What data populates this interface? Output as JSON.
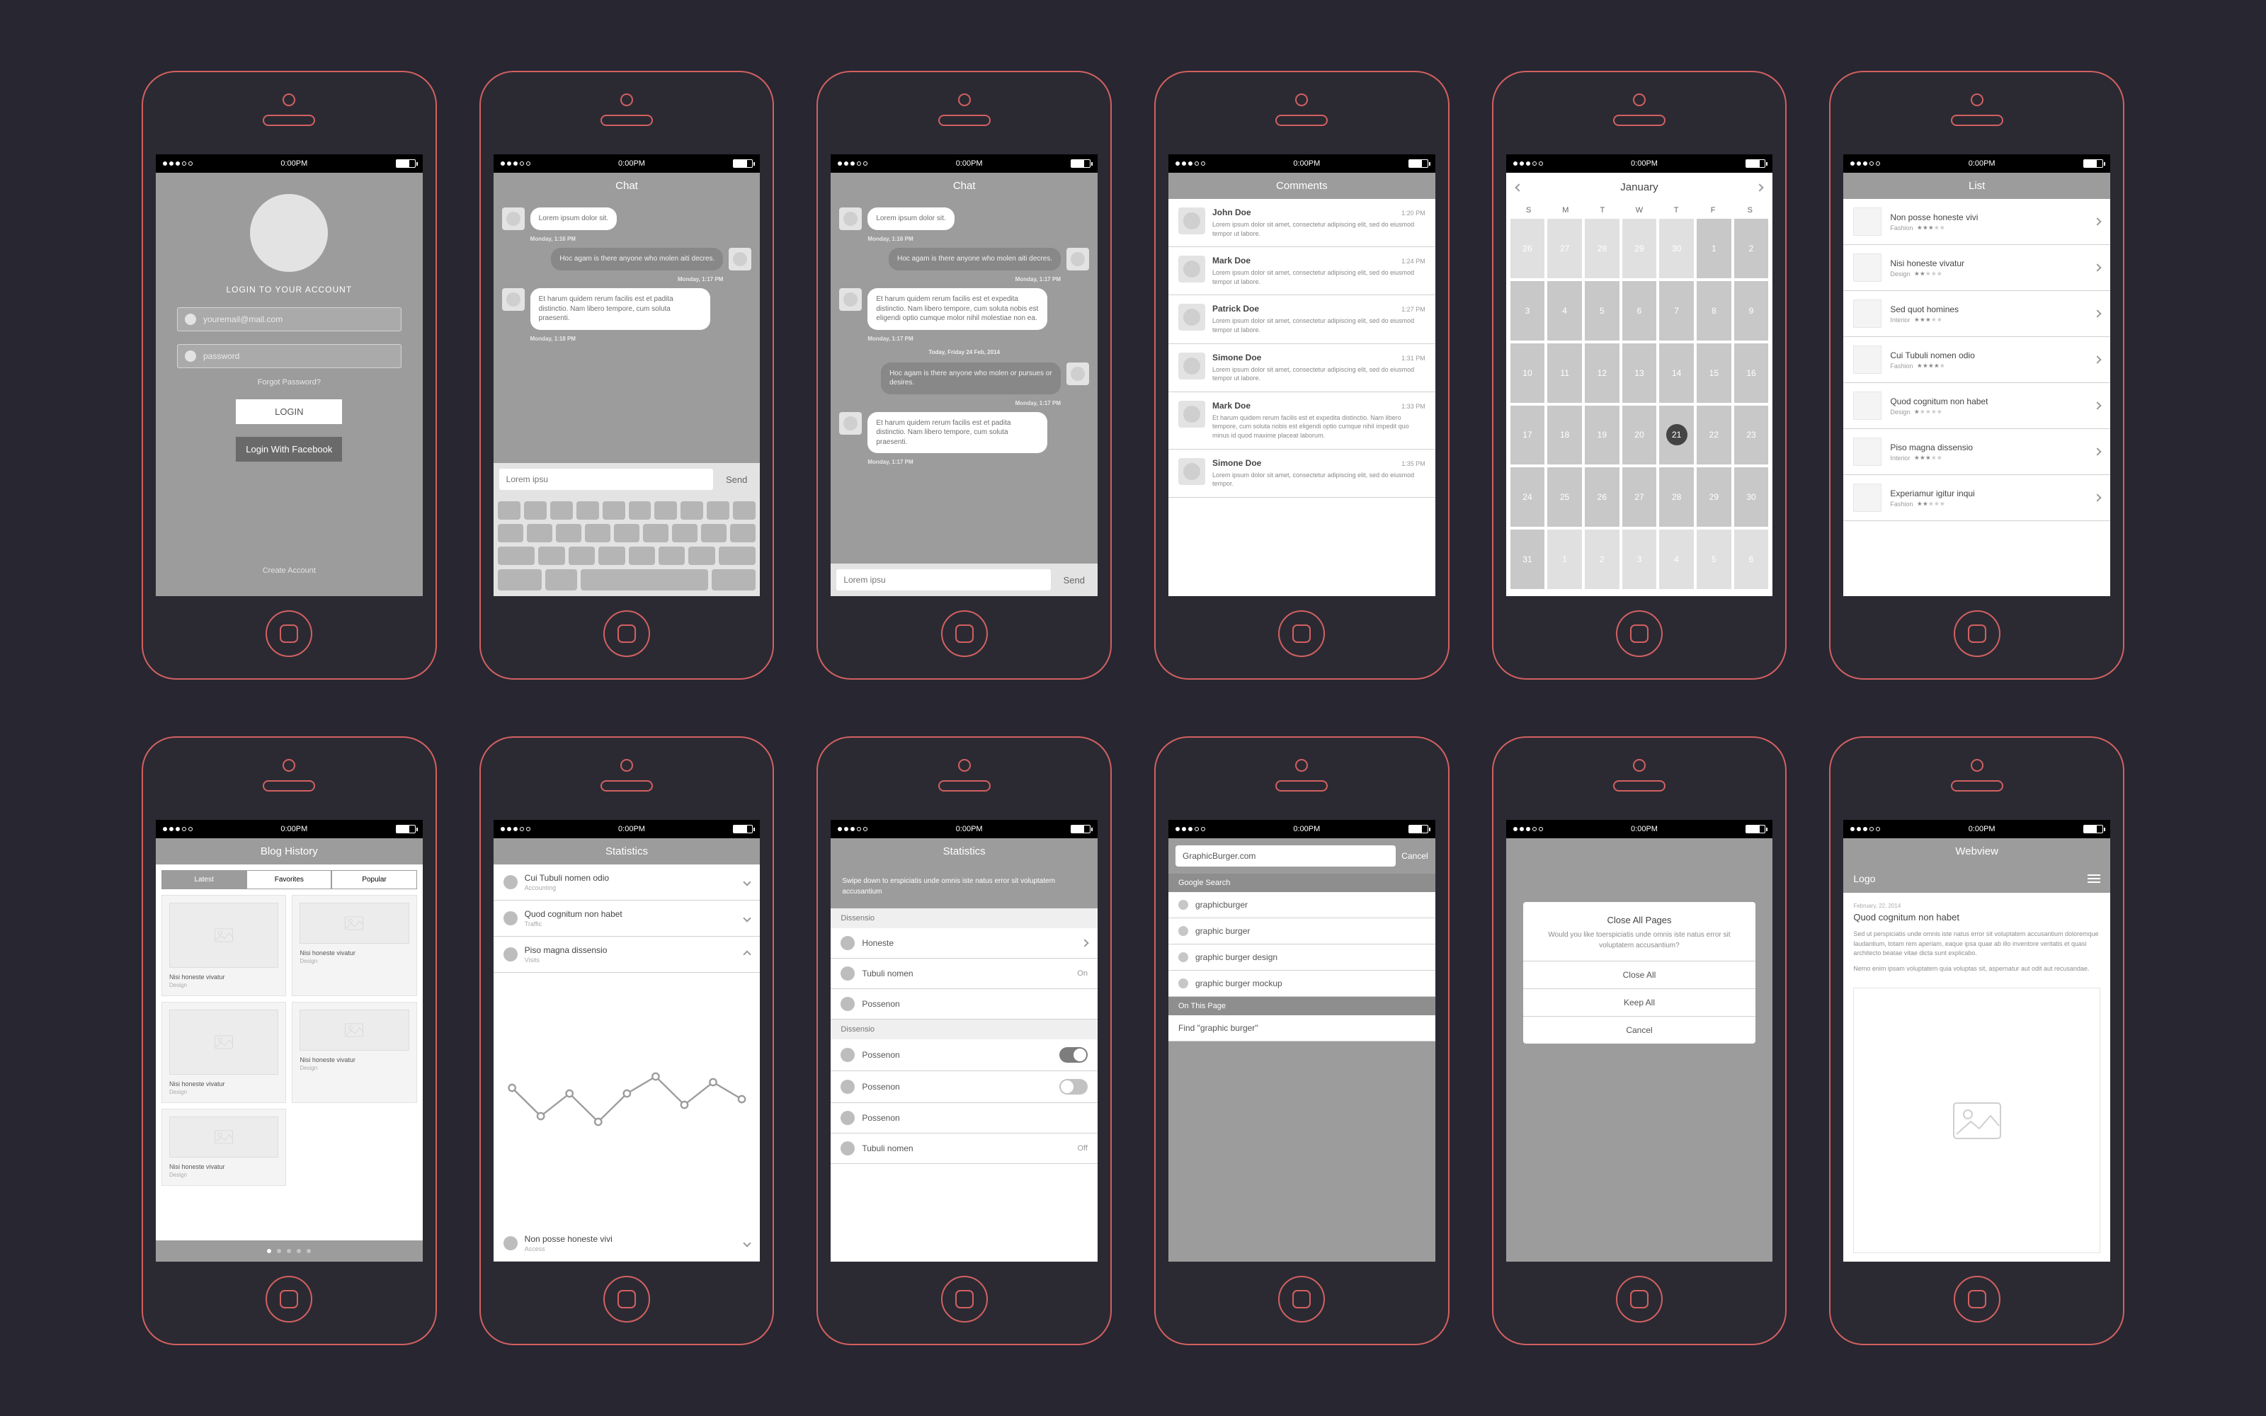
{
  "status": {
    "time": "0:00PM"
  },
  "login": {
    "heading": "LOGIN TO YOUR ACCOUNT",
    "email_placeholder": "youremail@mail.com",
    "password_placeholder": "password",
    "forgot": "Forgot Password?",
    "login_btn": "LOGIN",
    "fb_btn": "Login With Facebook",
    "create": "Create Account"
  },
  "chat": {
    "title": "Chat",
    "compose_placeholder": "Lorem ipsu",
    "send": "Send",
    "short": {
      "m1": "Lorem ipsum dolor sit.",
      "s1": "Monday, 1:16 PM",
      "m2": "Hoc agam is there anyone who molen aiti decres.",
      "s2": "Monday, 1:17 PM",
      "m3": "Et harum quidem rerum facilis est et padita distinctio. Nam libero tempore, cum soluta praesenti.",
      "s3": "Monday, 1:18 PM"
    },
    "long": {
      "m1": "Lorem ipsum dolor sit.",
      "s1": "Monday, 1:16 PM",
      "m2": "Hoc agam is there anyone who molen aiti decres.",
      "s2": "Monday, 1:17 PM",
      "m3": "Et harum quidem rerum facilis est et expedita distinctio. Nam libero tempore, cum soluta nobis est eligendi optio cumque molor nihil molestiae non ea.",
      "s3": "Monday, 1:17 PM",
      "day": "Today, Friday 24 Feb, 2014",
      "m4": "Hoc agam is there anyone who molen or pursues or desires.",
      "s4": "Monday, 1:17 PM",
      "m5": "Et harum quidem rerum facilis est et padita distinctio. Nam libero tempore, cum soluta praesenti.",
      "s5": "Monday, 1:17 PM"
    }
  },
  "comments": {
    "title": "Comments",
    "items": [
      {
        "name": "John Doe",
        "time": "1:20 PM",
        "text": "Lorem ipsum dolor sit amet, consectetur adipiscing elit, sed do eiusmod tempor ut labore."
      },
      {
        "name": "Mark Doe",
        "time": "1:24 PM",
        "text": "Lorem ipsum dolor sit amet, consectetur adipiscing elit, sed do eiusmod tempor ut labore."
      },
      {
        "name": "Patrick Doe",
        "time": "1:27 PM",
        "text": "Lorem ipsum dolor sit amet, consectetur adipiscing elit, sed do eiusmod tempor ut labore."
      },
      {
        "name": "Simone Doe",
        "time": "1:31 PM",
        "text": "Lorem ipsum dolor sit amet, consectetur adipiscing elit, sed do eiusmod tempor ut labore."
      },
      {
        "name": "Mark Doe",
        "time": "1:33 PM",
        "text": "Et harum quidem rerum facilis est et expedita distinctio. Nam libero tempore, cum soluta nobis est eligendi optio cumque nihil impedit quo minus id quod maxime placeat laborum."
      },
      {
        "name": "Simone Doe",
        "time": "1:35 PM",
        "text": "Lorem ipsum dolor sit amet, consectetur adipiscing elit, sed do eiusmod tempor."
      }
    ]
  },
  "calendar": {
    "month": "January",
    "dow": [
      "S",
      "M",
      "T",
      "W",
      "T",
      "F",
      "S"
    ],
    "rows": [
      [
        "26",
        "27",
        "28",
        "29",
        "30",
        "1",
        "2"
      ],
      [
        "3",
        "4",
        "5",
        "6",
        "7",
        "8",
        "9"
      ],
      [
        "10",
        "11",
        "12",
        "13",
        "14",
        "15",
        "16"
      ],
      [
        "17",
        "18",
        "19",
        "20",
        "21",
        "22",
        "23"
      ],
      [
        "24",
        "25",
        "26",
        "27",
        "28",
        "29",
        "30"
      ],
      [
        "31",
        "1",
        "2",
        "3",
        "4",
        "5",
        "6"
      ]
    ],
    "dim_start": 5,
    "dim_end_count": 6,
    "selected": "21"
  },
  "listview": {
    "title": "List",
    "items": [
      {
        "title": "Non posse honeste vivi",
        "cat": "Fashion",
        "rating": 3
      },
      {
        "title": "Nisi honeste vivatur",
        "cat": "Design",
        "rating": 2
      },
      {
        "title": "Sed quot homines",
        "cat": "Interior",
        "rating": 3
      },
      {
        "title": "Cui Tubuli nomen odio",
        "cat": "Fashion",
        "rating": 4
      },
      {
        "title": "Quod cognitum non habet",
        "cat": "Design",
        "rating": 1
      },
      {
        "title": "Piso magna dissensio",
        "cat": "Interior",
        "rating": 3
      },
      {
        "title": "Experiamur igitur inqui",
        "cat": "Fashion",
        "rating": 2
      }
    ]
  },
  "blog": {
    "title": "Blog History",
    "tabs": [
      "Latest",
      "Favorites",
      "Popular"
    ],
    "cards": [
      {
        "title": "Nisi honeste vivatur",
        "cat": "Design"
      },
      {
        "title": "Nisi honeste vivatur",
        "cat": "Design"
      },
      {
        "title": "Nisi honeste vivatur",
        "cat": "Design"
      },
      {
        "title": "Nisi honeste vivatur",
        "cat": "Design"
      },
      {
        "title": "Nisi honeste vivatur",
        "cat": "Design"
      }
    ]
  },
  "stats": {
    "title": "Statistics",
    "items": [
      {
        "title": "Cui Tubuli nomen odio",
        "sub": "Accounting"
      },
      {
        "title": "Quod cognitum non habet",
        "sub": "Traffic"
      },
      {
        "title": "Piso magna dissensio",
        "sub": "Visits"
      },
      {
        "title": "Non posse honeste vivi",
        "sub": "Access"
      }
    ]
  },
  "settings": {
    "title": "Statistics",
    "note": "Swipe down to erspiciatis unde omnis iste natus error sit voluptatem accusantium",
    "s1": "Dissensio",
    "r1": {
      "label": "Honeste"
    },
    "r2": {
      "label": "Tubuli nomen",
      "val": "On"
    },
    "r3": {
      "label": "Possenon"
    },
    "s2": "Dissensio",
    "r4": {
      "label": "Possenon"
    },
    "r5": {
      "label": "Possenon"
    },
    "r6": {
      "label": "Possenon"
    },
    "r7": {
      "label": "Tubuli nomen",
      "val": "Off"
    }
  },
  "search": {
    "query": "GraphicBurger.com",
    "cancel": "Cancel",
    "g1": "Google Search",
    "results": [
      "graphicburger",
      "graphic burger",
      "graphic burger design",
      "graphic burger mockup"
    ],
    "g2": "On This Page",
    "find": "Find \"graphic burger\""
  },
  "sheet": {
    "title": "Close All Pages",
    "msg": "Would you like toerspiciatis unde omnis iste natus error sit voluptatem accusantium?",
    "o1": "Close All",
    "o2": "Keep All",
    "o3": "Cancel"
  },
  "web": {
    "nav": "Webview",
    "logo": "Logo",
    "date": "February, 22, 2014",
    "title": "Quod cognitum non habet",
    "p1": "Sed ut perspiciatis unde omnis iste natus error sit volup­tatem accusantium doloremque laudantium, totam rem aperiam, eaque ipsa quae ab illo inventore veritatis et quasi architecto beatae vitae dicta sunt explicabo.",
    "p2": "Nemo enim ipsam voluptatem quia voluptas sit, aspernatur aut odit aut recusandae."
  },
  "chart_data": {
    "type": "line",
    "x": [
      1,
      2,
      3,
      4,
      5,
      6,
      7,
      8,
      9
    ],
    "values": [
      60,
      35,
      55,
      30,
      55,
      70,
      45,
      65,
      50
    ],
    "ylim": [
      0,
      100
    ]
  }
}
